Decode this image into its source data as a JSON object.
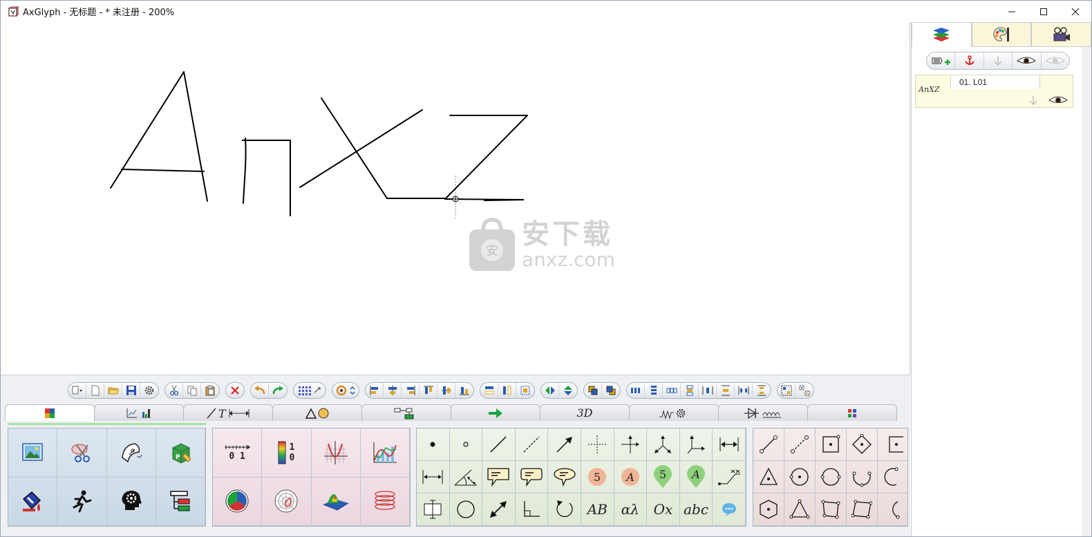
{
  "window": {
    "title": "AxGlyph - 无标题 - * 未注册 - 200%"
  },
  "watermark": {
    "line1": "安下载",
    "line2": "anxz.com"
  },
  "right_panel": {
    "tabs": [
      "layers-icon",
      "palette-icon",
      "projector-icon"
    ],
    "layers": [
      {
        "thumb": "AnXZ",
        "label": "01. L01"
      }
    ]
  },
  "bottom": {
    "category_tabs": [
      {
        "icon": "puzzle-icon",
        "text": ""
      },
      {
        "icon": "chart-icon",
        "text": ""
      },
      {
        "icon": "line-text-icon",
        "text": ""
      },
      {
        "icon": "shapes-icon",
        "text": ""
      },
      {
        "icon": "flowchart-icon",
        "text": ""
      },
      {
        "icon": "arrow-icon",
        "text": ""
      },
      {
        "icon": "3d-icon",
        "text": "3D"
      },
      {
        "icon": "circuit-icon",
        "text": ""
      },
      {
        "icon": "electronics-icon",
        "text": ""
      },
      {
        "icon": "grid-icon",
        "text": ""
      }
    ],
    "symbol_panel": {
      "ab": "AB",
      "alpha_lambda": "αλ",
      "ox": "Ox",
      "abc": "abc",
      "five_a": "5",
      "letter_a": "A"
    },
    "chart_panel": {
      "ruler_numbers": "0 1",
      "colorbar_top": "1",
      "colorbar_bottom": "0"
    }
  },
  "colors": {
    "accent_green": "#1aa33a",
    "title_bar": "#ffffff",
    "canvas": "#ffffff"
  }
}
